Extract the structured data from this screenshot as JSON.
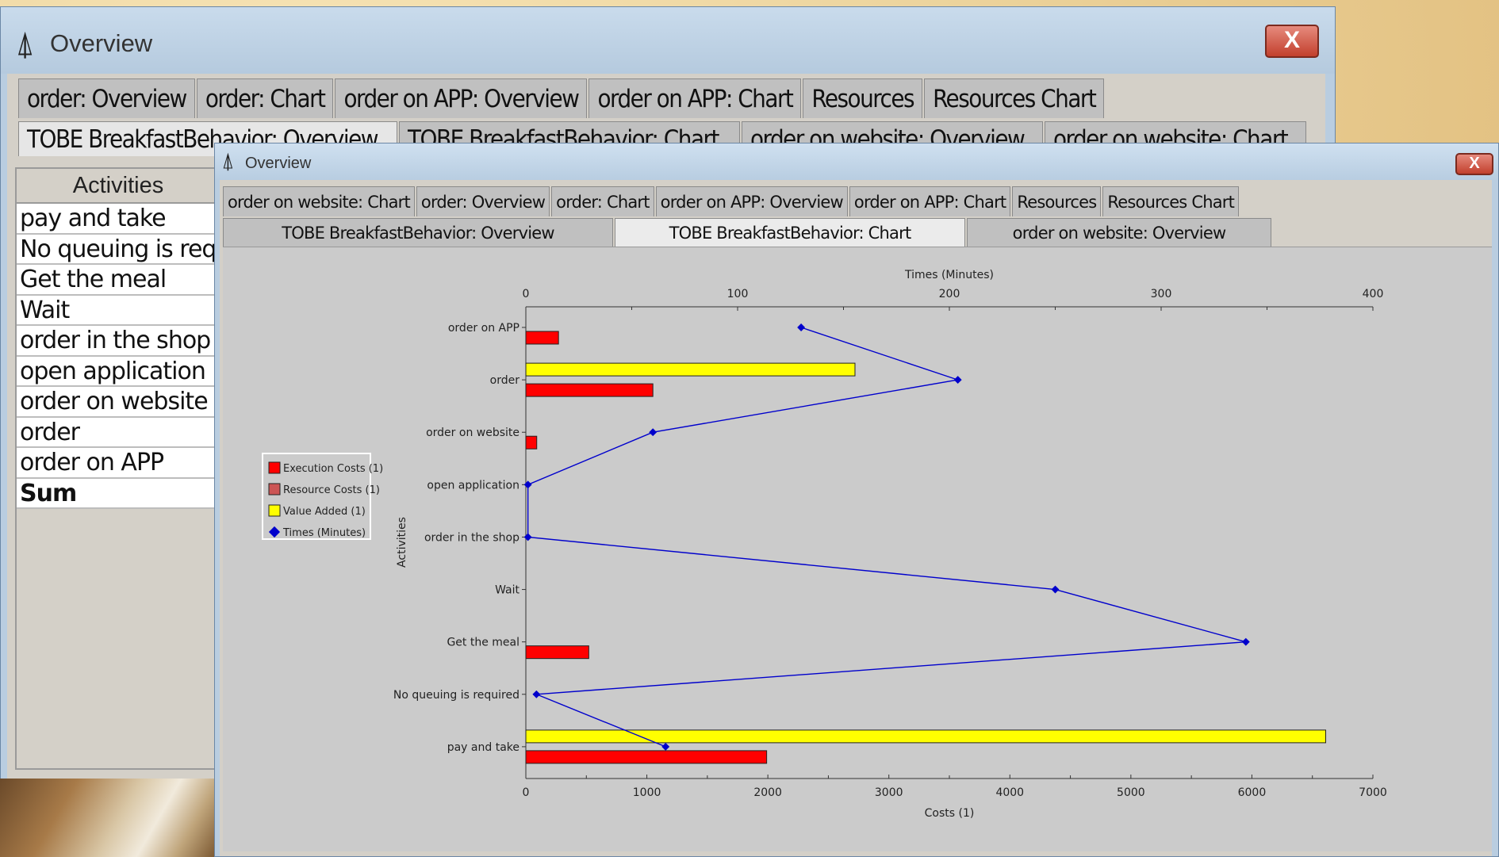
{
  "back_window": {
    "title": "Overview",
    "close_label": "X",
    "tabs_row1": [
      "order: Overview",
      "order: Chart",
      "order on APP: Overview",
      "order on APP: Chart",
      "Resources",
      "Resources Chart"
    ],
    "tabs_row2": [
      "TOBE BreakfastBehavior: Overview",
      "TOBE BreakfastBehavior: Chart",
      "order on website: Overview",
      "order on website: Chart"
    ],
    "table": {
      "header": "Activities",
      "rows": [
        "pay and take",
        "No queuing is required",
        "Get the meal",
        "Wait",
        "order in the shop",
        "open application",
        "order on website",
        "order",
        "order on APP",
        "Sum"
      ]
    }
  },
  "front_window": {
    "title": "Overview",
    "close_label": "X",
    "tabs_row1": [
      "order on website: Chart",
      "order: Overview",
      "order: Chart",
      "order on APP: Overview",
      "order on APP: Chart",
      "Resources",
      "Resources Chart"
    ],
    "tabs_row2": [
      "TOBE BreakfastBehavior: Overview",
      "TOBE BreakfastBehavior: Chart",
      "order on website: Overview"
    ],
    "selected_tab": "TOBE BreakfastBehavior: Chart"
  },
  "chart_data": {
    "type": "bar",
    "orientation": "horizontal",
    "categories": [
      "order on APP",
      "order",
      "order on website",
      "open application",
      "order in the shop",
      "Wait",
      "Get the meal",
      "No queuing is required",
      "pay and take"
    ],
    "series": [
      {
        "name": "Execution Costs (1)",
        "axis": "bottom",
        "color": "#ff0000",
        "values": [
          270,
          1050,
          90,
          0,
          0,
          0,
          520,
          0,
          1990
        ]
      },
      {
        "name": "Resource Costs (1)",
        "axis": "bottom",
        "color": "#cc5555",
        "values": [
          0,
          0,
          0,
          0,
          0,
          0,
          0,
          0,
          0
        ]
      },
      {
        "name": "Value Added (1)",
        "axis": "bottom",
        "color": "#ffff00",
        "values": [
          0,
          2720,
          0,
          0,
          0,
          0,
          0,
          0,
          6610
        ]
      },
      {
        "name": "Times (Minutes)",
        "axis": "top",
        "type": "line",
        "color": "#0000cc",
        "values": [
          130,
          204,
          60,
          1,
          1,
          250,
          340,
          5,
          66
        ]
      }
    ],
    "x_bottom": {
      "label": "Costs (1)",
      "range": [
        0,
        7000
      ],
      "ticks": [
        0,
        1000,
        2000,
        3000,
        4000,
        5000,
        6000,
        7000
      ]
    },
    "x_top": {
      "label": "Times (Minutes)",
      "range": [
        0,
        400
      ],
      "ticks": [
        0,
        100,
        200,
        300,
        400
      ]
    },
    "ylabel": "Activities",
    "legend_position": "left"
  }
}
